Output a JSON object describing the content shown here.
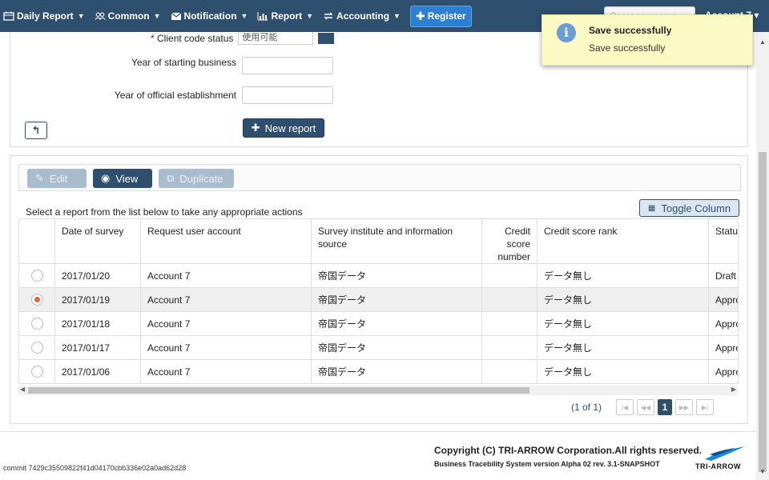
{
  "nav": {
    "items": [
      {
        "label": "Daily Report",
        "icon": "calendar-icon"
      },
      {
        "label": "Common",
        "icon": "users-icon"
      },
      {
        "label": "Notification",
        "icon": "envelope-icon"
      },
      {
        "label": "Report",
        "icon": "bar-chart-icon"
      },
      {
        "label": "Accounting",
        "icon": "exchange-icon"
      }
    ],
    "register_label": "Register",
    "company_placeholder": "Company name",
    "account_label": "Account 7"
  },
  "form": {
    "client_code_status_label": "Client code status",
    "client_code_status_value": "使用可能",
    "year_start_label": "Year of starting business",
    "year_est_label": "Year of official establishment",
    "year_start_value": "",
    "year_est_value": "",
    "new_report_label": "New report"
  },
  "toolbar": {
    "edit_label": "Edit",
    "view_label": "View",
    "duplicate_label": "Duplicate",
    "toggle_column_label": "Toggle Column"
  },
  "instruction": "Select a report from the list below to take any appropriate actions",
  "table": {
    "headers": [
      "Date of survey",
      "Request user account",
      "Survey institute and information source",
      "Credit score number",
      "Credit score rank",
      "Status"
    ],
    "rows": [
      {
        "date": "2017/01/20",
        "account": "Account 7",
        "source": "帝国データ",
        "score": "",
        "rank": "データ無し",
        "status": "Draft",
        "selected": false
      },
      {
        "date": "2017/01/19",
        "account": "Account 7",
        "source": "帝国データ",
        "score": "",
        "rank": "データ無し",
        "status": "Approved",
        "selected": true
      },
      {
        "date": "2017/01/18",
        "account": "Account 7",
        "source": "帝国データ",
        "score": "",
        "rank": "データ無し",
        "status": "Approved",
        "selected": false
      },
      {
        "date": "2017/01/17",
        "account": "Account 7",
        "source": "帝国データ",
        "score": "",
        "rank": "データ無し",
        "status": "Approved",
        "selected": false
      },
      {
        "date": "2017/01/06",
        "account": "Account 7",
        "source": "帝国データ",
        "score": "",
        "rank": "データ無し",
        "status": "Approved",
        "selected": false
      }
    ]
  },
  "pagination": {
    "info": "(1 of 1)",
    "current_page": "1"
  },
  "footer": {
    "commit": "commit 7429c35509822f41d04170cbb336e02a0ad62d28",
    "copyright": "Copyright (C) TRI-ARROW Corporation.All rights reserved.",
    "version": "Business Tracebility System version Alpha 02 rev. 3.1-SNAPSHOT",
    "logo_text": "TRI-ARROW"
  },
  "toast": {
    "title": "Save successfully",
    "message": "Save successfully"
  },
  "colors": {
    "navbar": "#2f4f6e",
    "accent": "#2d7fd1",
    "selected_radio": "#e2663a",
    "toast_bg": "#fbf9c4"
  }
}
